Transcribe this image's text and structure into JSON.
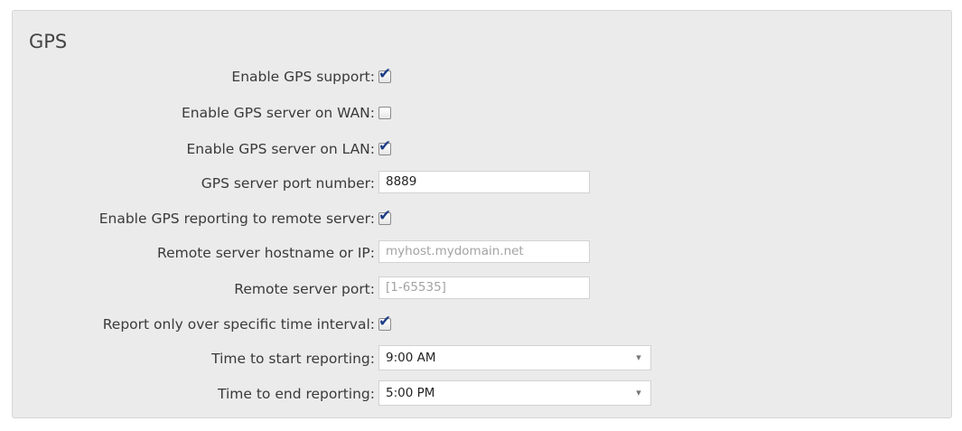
{
  "section": {
    "title": "GPS"
  },
  "fields": {
    "enable_gps_support": {
      "label": "Enable GPS support:",
      "checked": true
    },
    "enable_gps_server_wan": {
      "label": "Enable GPS server on WAN:",
      "checked": false
    },
    "enable_gps_server_lan": {
      "label": "Enable GPS server on LAN:",
      "checked": true
    },
    "gps_server_port": {
      "label": "GPS server port number:",
      "value": "8889"
    },
    "enable_remote_reporting": {
      "label": "Enable GPS reporting to remote server:",
      "checked": true
    },
    "remote_hostname": {
      "label": "Remote server hostname or IP:",
      "placeholder": "myhost.mydomain.net"
    },
    "remote_port": {
      "label": "Remote server port:",
      "placeholder": "[1-65535]"
    },
    "report_interval_only": {
      "label": "Report only over specific time interval:",
      "checked": true
    },
    "start_time": {
      "label": "Time to start reporting:",
      "selected": "9:00 AM"
    },
    "end_time": {
      "label": "Time to end reporting:",
      "selected": "5:00 PM"
    }
  },
  "icons": {
    "checkmark": "✔",
    "dropdown_arrow": "▾"
  },
  "colors": {
    "panel_background": "#ebebeb",
    "checkmark": "#1f3f86",
    "label_text": "#3a3a3a",
    "placeholder_text": "#a3a3a3"
  }
}
